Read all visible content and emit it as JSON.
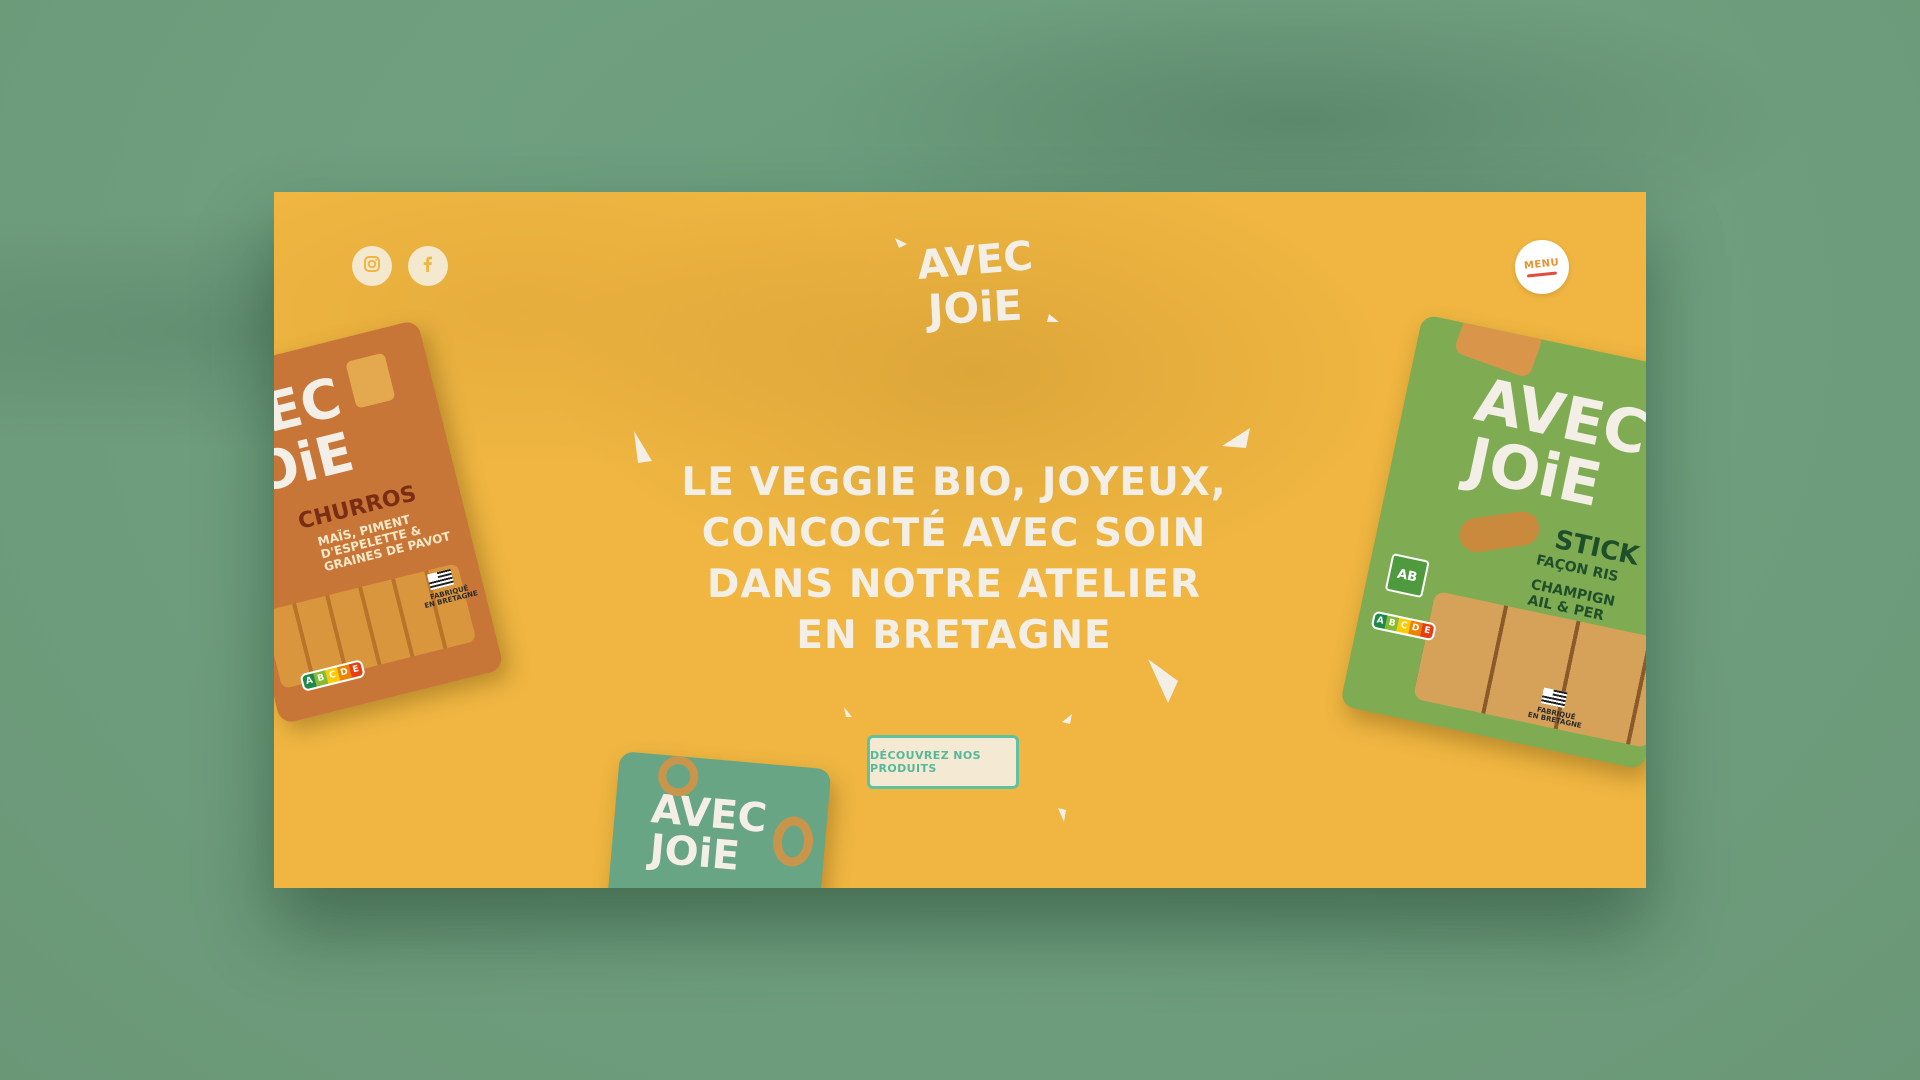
{
  "brand": {
    "logo_line1": "AVEC",
    "logo_line2": "JOiE"
  },
  "social": {
    "icons": [
      "instagram-icon",
      "facebook-icon"
    ]
  },
  "header": {
    "menu_label": "MENU"
  },
  "hero": {
    "headline_lines": [
      "LE VEGGIE BIO, JOYEUX,",
      "CONCOCTÉ AVEC SOIN",
      "DANS NOTRE ATELIER",
      "EN BRETAGNE"
    ],
    "cta_label": "DÉCOUVREZ NOS PRODUITS"
  },
  "products": {
    "left": {
      "brand_line1": "VEC",
      "brand_line2": "JOiE",
      "title": "CHURROS",
      "subtitle": [
        "MAÏS, PIMENT",
        "D'ESPELETTE &",
        "GRAINES DE PAVOT"
      ],
      "nutri_label": "NUTRI-SCORE",
      "nutri": [
        "A",
        "B",
        "C",
        "D",
        "E"
      ],
      "origin": [
        "FABRIQUÉ",
        "EN BRETAGNE"
      ]
    },
    "right": {
      "brand_line1": "AVEC",
      "brand_line2": "JOiE",
      "title": "STICK",
      "subtitle": [
        "FAÇON RIS",
        "CHAMPIGN",
        "AIL & PER"
      ],
      "organic": "AB",
      "nutri_label": "NUTRI-SCORE",
      "nutri": [
        "A",
        "B",
        "C",
        "D",
        "E"
      ],
      "origin": [
        "FABRIQUÉ",
        "EN BRETAGNE"
      ]
    },
    "bottom": {
      "brand_line1": "AVEC",
      "brand_line2": "JOiE"
    }
  },
  "colors": {
    "page_bg": "#6f9f7f",
    "hero_bg": "#f0b641",
    "headline": "#f3efe6",
    "cta_border": "#5fc1a3",
    "menu_text": "#e8912d",
    "pack_orange": "#c77638",
    "pack_green": "#7fac52",
    "pack_teal": "#68a584"
  }
}
